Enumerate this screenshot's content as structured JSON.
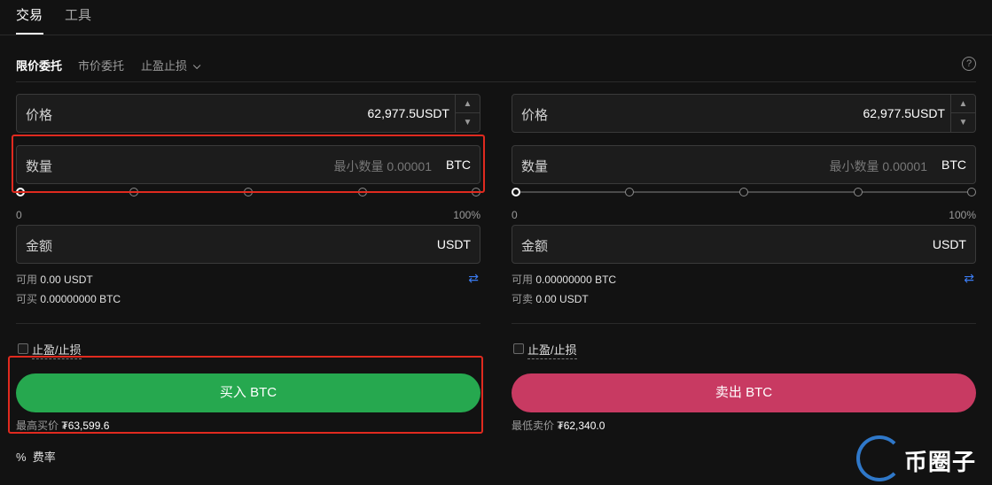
{
  "top_tabs": {
    "trade": "交易",
    "tools": "工具"
  },
  "order_types": {
    "limit": "限价委托",
    "market": "市价委托",
    "tpsl": "止盈止损"
  },
  "help_icon": "?",
  "buy": {
    "price_label": "价格",
    "price_value": "62,977.5",
    "price_unit": "USDT",
    "qty_label": "数量",
    "qty_placeholder": "最小数量 0.00001",
    "qty_unit": "BTC",
    "slider_min": "0",
    "slider_max": "100%",
    "slider_level_percent": 0,
    "amount_label": "金额",
    "amount_unit": "USDT",
    "avail_label": "可用",
    "avail_value": "0.00 USDT",
    "can_label": "可买",
    "can_value": "0.00000000 BTC",
    "tpsl_label": "止盈/止损",
    "button_label": "买入 BTC",
    "best_label": "最高买价",
    "best_value": "₮63,599.6"
  },
  "sell": {
    "price_label": "价格",
    "price_value": "62,977.5",
    "price_unit": "USDT",
    "qty_label": "数量",
    "qty_placeholder": "最小数量 0.00001",
    "qty_unit": "BTC",
    "slider_min": "0",
    "slider_max": "100%",
    "slider_level_percent": 0,
    "amount_label": "金额",
    "amount_unit": "USDT",
    "avail_label": "可用",
    "avail_value": "0.00000000 BTC",
    "can_label": "可卖",
    "can_value": "0.00 USDT",
    "tpsl_label": "止盈/止损",
    "button_label": "卖出 BTC",
    "best_label": "最低卖价",
    "best_value": "₮62,340.0"
  },
  "fee": {
    "icon": "%",
    "label": "费率"
  },
  "watermark": {
    "text": "币圈子"
  },
  "colors": {
    "buy": "#26a84f",
    "sell": "#c83a62",
    "highlight": "#e02a1f",
    "accent": "#3b7bf0"
  }
}
